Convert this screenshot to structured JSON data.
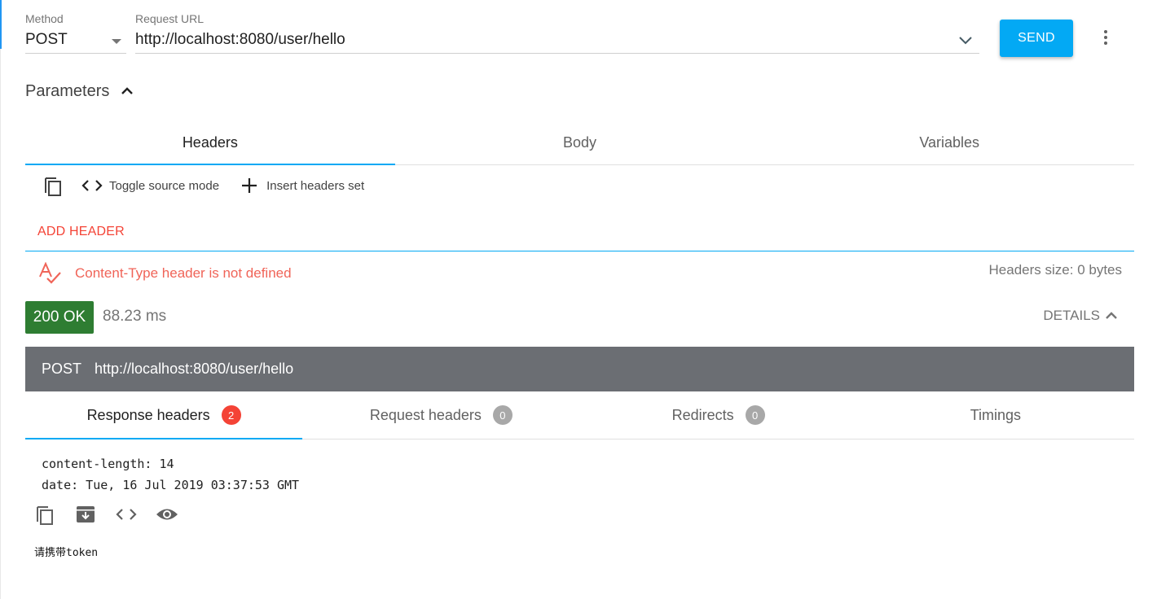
{
  "request": {
    "method_label": "Method",
    "method_value": "POST",
    "url_label": "Request URL",
    "url_value": "http://localhost:8080/user/hello",
    "send_label": "SEND"
  },
  "parameters": {
    "title": "Parameters",
    "tabs": [
      {
        "label": "Headers",
        "active": true
      },
      {
        "label": "Body",
        "active": false
      },
      {
        "label": "Variables",
        "active": false
      }
    ],
    "toolbar": {
      "toggle_source_label": "Toggle source mode",
      "insert_headers_label": "Insert headers set"
    },
    "add_header_label": "ADD HEADER",
    "warning_text": "Content-Type header is not defined",
    "headers_size_text": "Headers size: 0 bytes"
  },
  "response": {
    "status": "200 OK",
    "time": "88.23 ms",
    "details_label": "DETAILS",
    "request_method": "POST",
    "request_url": "http://localhost:8080/user/hello",
    "tabs": [
      {
        "label": "Response headers",
        "count": "2",
        "active": true
      },
      {
        "label": "Request headers",
        "count": "0",
        "active": false
      },
      {
        "label": "Redirects",
        "count": "0",
        "active": false
      },
      {
        "label": "Timings",
        "count": "",
        "active": false
      }
    ],
    "headers": [
      "content-length: 14",
      "date: Tue, 16 Jul 2019 03:37:53 GMT"
    ],
    "body": "请携带token"
  },
  "colors": {
    "accent": "#03a9f4",
    "error": "#f44336",
    "success": "#2e7d32",
    "request_bar": "#6b6e73"
  },
  "icons": {
    "copy": "copy-icon",
    "code": "code-icon",
    "add": "add-icon",
    "spellcheck": "spellcheck-icon",
    "archive": "archive-icon",
    "view": "eye-icon",
    "more": "more-vert-icon"
  }
}
